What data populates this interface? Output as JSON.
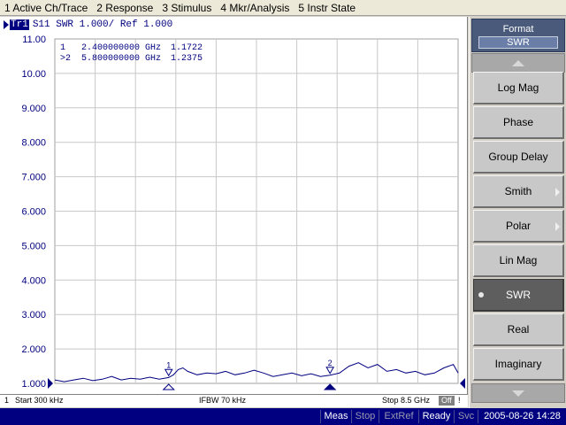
{
  "menubar": {
    "items": [
      "1 Active Ch/Trace",
      "2 Response",
      "3 Stimulus",
      "4 Mkr/Analysis",
      "5 Instr State"
    ]
  },
  "trace": {
    "tag": "Tr1",
    "header": "S11  SWR 1.000/ Ref 1.000"
  },
  "markers": [
    {
      "prefix": " 1",
      "freq": "2.400000000 GHz",
      "value": "1.1722"
    },
    {
      "prefix": ">2",
      "freq": "5.800000000 GHz",
      "value": "1.2375"
    }
  ],
  "info": {
    "channel": "1",
    "start": "Start 300 kHz",
    "ifbw": "IFBW 70 kHz",
    "stop": "Stop 8.5 GHz",
    "off": "Off",
    "flag": "!"
  },
  "status": {
    "meas": "Meas",
    "stop": "Stop",
    "extref": "ExtRef",
    "ready": "Ready",
    "svc": "Svc",
    "datetime": "2005-08-26 14:28"
  },
  "softkeys": {
    "title": "Format",
    "current": "SWR",
    "items": [
      "Log Mag",
      "Phase",
      "Group Delay",
      "Smith",
      "Polar",
      "Lin Mag",
      "SWR",
      "Real",
      "Imaginary"
    ],
    "selected_index": 6
  },
  "chart_data": {
    "type": "line",
    "xlim": [
      0.0003,
      8.5
    ],
    "ylim": [
      1.0,
      11.0
    ],
    "ytick_labels": [
      "11.00",
      "10.00",
      "9.000",
      "8.000",
      "7.000",
      "6.000",
      "5.000",
      "4.000",
      "3.000",
      "2.000",
      "1.000"
    ],
    "grid": true,
    "trace_color": "#000080",
    "marker_labels": [
      "1",
      "2"
    ],
    "markers": [
      {
        "label": "1",
        "x": 2.4,
        "y": 1.1722
      },
      {
        "label": "2",
        "x": 5.8,
        "y": 1.2375
      }
    ],
    "series": [
      {
        "x": [
          0.0003,
          0.2,
          0.4,
          0.6,
          0.8,
          1.0,
          1.2,
          1.4,
          1.6,
          1.8,
          2.0,
          2.2,
          2.4,
          2.5,
          2.6,
          2.7,
          2.8,
          3.0,
          3.2,
          3.4,
          3.6,
          3.8,
          4.0,
          4.2,
          4.4,
          4.6,
          4.8,
          5.0,
          5.2,
          5.4,
          5.6,
          5.8,
          6.0,
          6.2,
          6.4,
          6.6,
          6.8,
          7.0,
          7.2,
          7.4,
          7.6,
          7.8,
          8.0,
          8.2,
          8.4,
          8.5
        ],
        "y": [
          1.1,
          1.05,
          1.1,
          1.15,
          1.08,
          1.12,
          1.2,
          1.1,
          1.15,
          1.12,
          1.18,
          1.12,
          1.17,
          1.25,
          1.4,
          1.45,
          1.35,
          1.25,
          1.3,
          1.28,
          1.35,
          1.25,
          1.3,
          1.38,
          1.3,
          1.2,
          1.25,
          1.3,
          1.22,
          1.28,
          1.2,
          1.24,
          1.3,
          1.5,
          1.6,
          1.45,
          1.55,
          1.35,
          1.4,
          1.3,
          1.35,
          1.25,
          1.3,
          1.45,
          1.55,
          1.3
        ]
      }
    ]
  }
}
